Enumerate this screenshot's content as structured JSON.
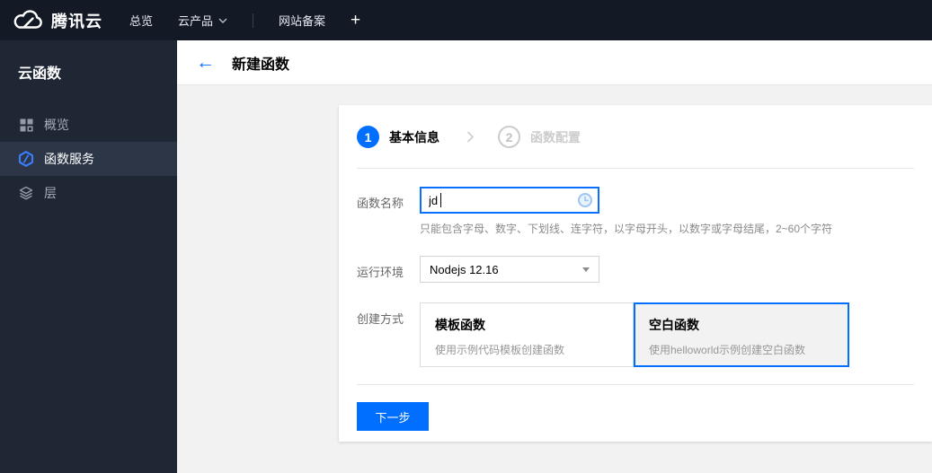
{
  "topnav": {
    "brand": "腾讯云",
    "items": [
      {
        "label": "总览"
      },
      {
        "label": "云产品"
      },
      {
        "label": "网站备案"
      }
    ],
    "plus_label": "+"
  },
  "sidebar": {
    "title": "云函数",
    "items": [
      {
        "label": "概览",
        "icon": "grid-icon",
        "selected": false
      },
      {
        "label": "函数服务",
        "icon": "scf-hexagon-icon",
        "selected": true
      },
      {
        "label": "层",
        "icon": "layers-icon",
        "selected": false
      }
    ]
  },
  "header": {
    "title": "新建函数"
  },
  "wizard": {
    "steps": [
      {
        "num": "1",
        "label": "基本信息",
        "active": true
      },
      {
        "num": "2",
        "label": "函数配置",
        "active": false
      }
    ]
  },
  "form": {
    "name": {
      "label": "函数名称",
      "value": "jd",
      "hint": "只能包含字母、数字、下划线、连字符，以字母开头，以数字或字母结尾，2~60个字符"
    },
    "runtime": {
      "label": "运行环境",
      "value": "Nodejs 12.16"
    },
    "method": {
      "label": "创建方式",
      "options": [
        {
          "title": "模板函数",
          "desc": "使用示例代码模板创建函数",
          "selected": false
        },
        {
          "title": "空白函数",
          "desc": "使用helloworld示例创建空白函数",
          "selected": true
        }
      ]
    }
  },
  "footer": {
    "next_label": "下一步"
  },
  "colors": {
    "accent": "#006eff",
    "navbar_bg": "#131a26",
    "sidebar_bg": "#1f2634",
    "sidebar_selected_bg": "#2c3647"
  }
}
